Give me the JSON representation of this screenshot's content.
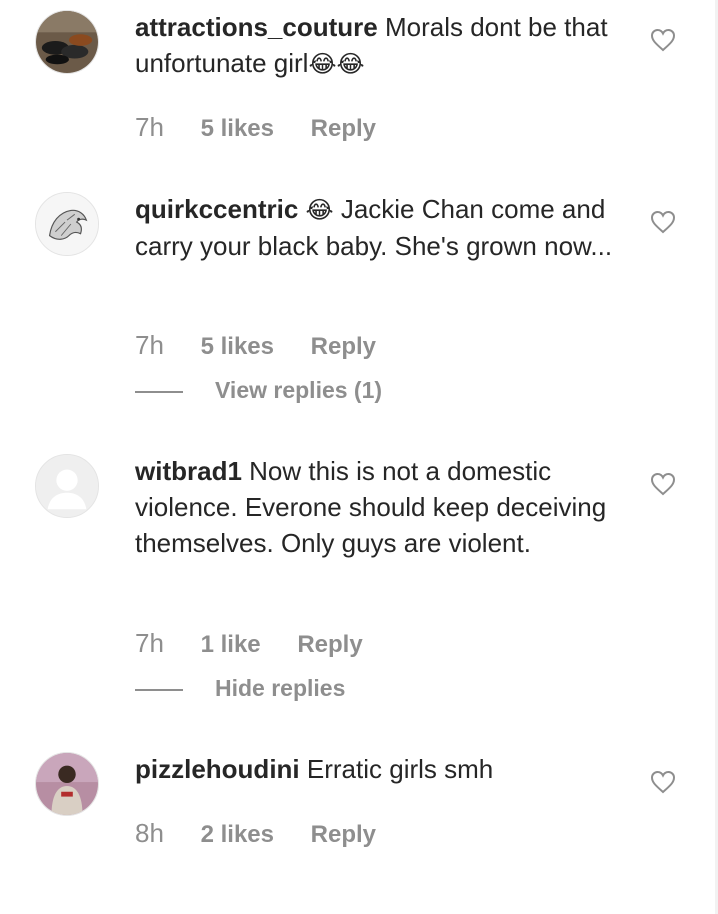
{
  "comments": [
    {
      "username": "attractions_couture",
      "text": "Morals dont be that unfortunate girl",
      "emoji": "😂😂",
      "time": "7h",
      "likes": "5 likes",
      "reply": "Reply",
      "avatar": "shoes-photo-avatar",
      "heart_icon": "heart-outline-icon"
    },
    {
      "username": "quirkccentric",
      "emoji": "😂",
      "text": "Jackie Chan come and carry your black baby. She's grown now...",
      "time": "7h",
      "likes": "5 likes",
      "reply": "Reply",
      "replies_toggle": "View replies (1)",
      "avatar": "lion-sketch-avatar",
      "heart_icon": "heart-outline-icon"
    },
    {
      "username": "witbrad1",
      "text": "Now this is not a domestic violence. Everone should keep deceiving themselves. Only guys are violent.",
      "time": "7h",
      "likes": "1 like",
      "reply": "Reply",
      "replies_toggle": "Hide replies",
      "avatar": "default-person-avatar",
      "heart_icon": "heart-outline-icon"
    },
    {
      "username": "pizzlehoudini",
      "text": "Erratic girls smh",
      "time": "8h",
      "likes": "2 likes",
      "reply": "Reply",
      "avatar": "person-photo-avatar",
      "heart_icon": "heart-outline-icon"
    }
  ],
  "colors": {
    "text": "#262626",
    "meta": "#8e8e8e",
    "heart": "#8e8e8e",
    "background": "#ffffff"
  }
}
